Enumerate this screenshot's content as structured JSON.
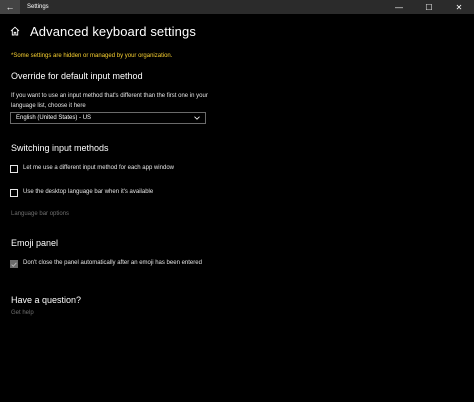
{
  "window": {
    "title": "Settings",
    "back_glyph": "←",
    "minimize_glyph": "—",
    "maximize_glyph": "☐",
    "close_glyph": "✕"
  },
  "header": {
    "icon": "home-icon",
    "title": "Advanced keyboard settings"
  },
  "notice": "*Some settings are hidden or managed by your organization.",
  "override": {
    "heading": "Override for default input method",
    "description": "If you want to use an input method that's different than the first one in your language list, choose it here",
    "dropdown_value": "English (United States) - US"
  },
  "switching": {
    "heading": "Switching input methods",
    "option1": {
      "label": "Let me use a different input method for each app window",
      "checked": false
    },
    "option2": {
      "label": "Use the desktop language bar when it's available",
      "checked": false
    },
    "language_bar_link": "Language bar options"
  },
  "emoji": {
    "heading": "Emoji panel",
    "option": {
      "label": "Don't close the panel automatically after an emoji has been entered",
      "checked": true
    }
  },
  "help": {
    "heading": "Have a question?",
    "link": "Get help"
  },
  "colors": {
    "notice": "#f8d030",
    "disabled_text": "#6e6e6e",
    "titlebar": "#2b2b2b"
  }
}
